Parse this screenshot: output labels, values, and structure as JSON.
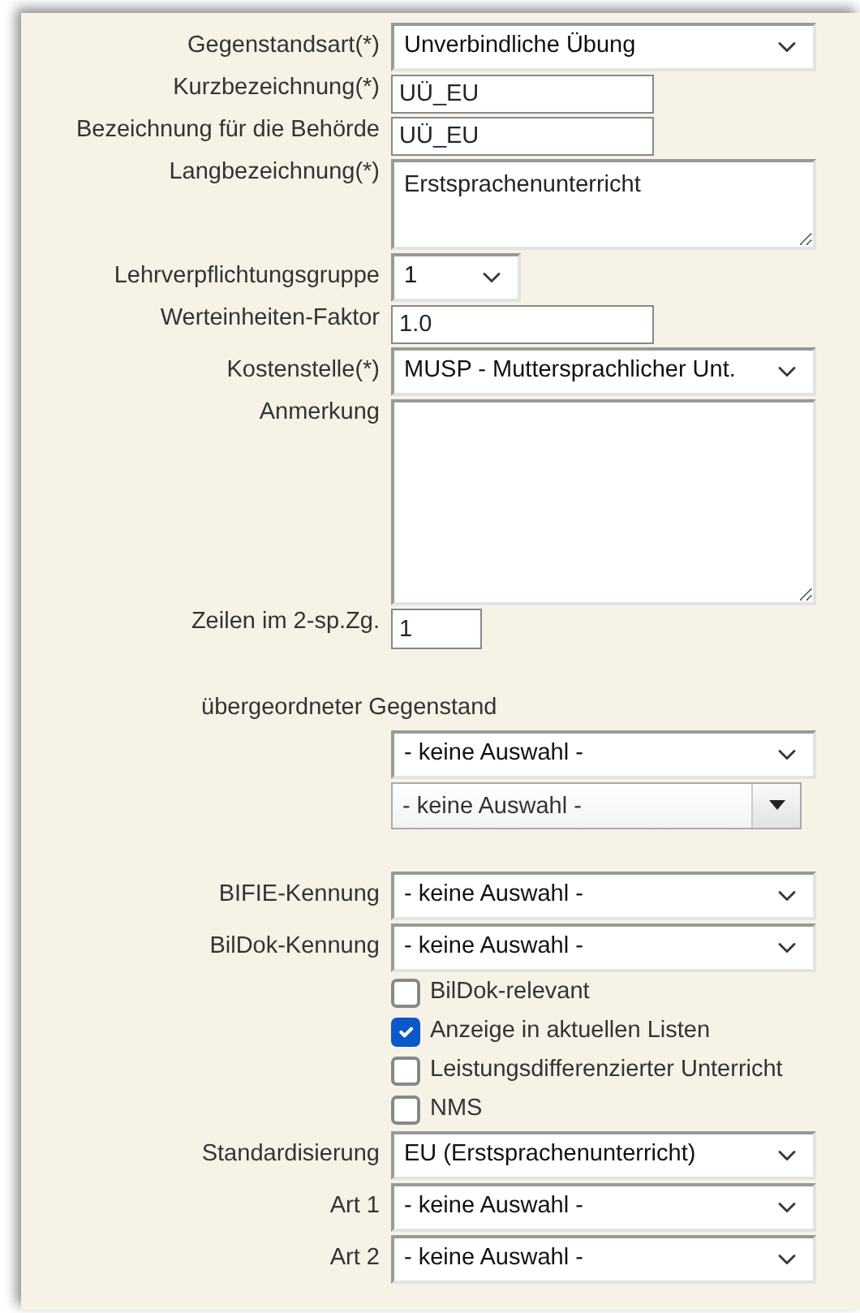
{
  "fields": [
    {
      "kind": "select",
      "label": "Gegenstandsart(*)",
      "value": "Unverbindliche Übung"
    },
    {
      "kind": "input",
      "label": "Kurzbezeichnung(*)",
      "value": "UÜ_EU"
    },
    {
      "kind": "input",
      "label": "Bezeichnung für die Behörde",
      "value": "UÜ_EU"
    },
    {
      "kind": "textarea",
      "label": "Langbezeichnung(*)",
      "value": "Erstsprachenunterricht"
    },
    {
      "kind": "short_select",
      "label": "Lehrverpflichtungsgruppe",
      "value": "1"
    },
    {
      "kind": "input",
      "label": "Werteinheiten-Faktor",
      "value": "1.0"
    },
    {
      "kind": "select",
      "label": "Kostenstelle(*)",
      "value": "MUSP - Muttersprachlicher Unt."
    },
    {
      "kind": "big_textarea",
      "label": "Anmerkung"
    },
    {
      "kind": "tiny_input",
      "label": "Zeilen im 2-sp.Zg.",
      "value": "1"
    },
    {
      "kind": "heading",
      "label": "übergeordneter Gegenstand"
    },
    {
      "kind": "select",
      "value": "- keine Auswahl -"
    },
    {
      "kind": "combo",
      "value": "- keine Auswahl -"
    },
    {
      "kind": "select",
      "label": "BIFIE-Kennung",
      "value": "- keine Auswahl -"
    },
    {
      "kind": "select",
      "label": "BilDok-Kennung",
      "value": "- keine Auswahl -"
    },
    {
      "kind": "checkbox",
      "label": "BilDok-relevant",
      "checked": false
    },
    {
      "kind": "checkbox",
      "label": "Anzeige in aktuellen Listen",
      "checked": true
    },
    {
      "kind": "checkbox",
      "label": "Leistungsdifferenzierter Unterricht",
      "checked": false
    },
    {
      "kind": "checkbox",
      "label": "NMS",
      "checked": false
    },
    {
      "kind": "select",
      "label": "Standardisierung",
      "value": "EU (Erstsprachenunterricht)"
    },
    {
      "kind": "select",
      "label": "Art 1",
      "value": "- keine Auswahl -"
    },
    {
      "kind": "select",
      "label": "Art 2",
      "value": "- keine Auswahl -"
    }
  ]
}
